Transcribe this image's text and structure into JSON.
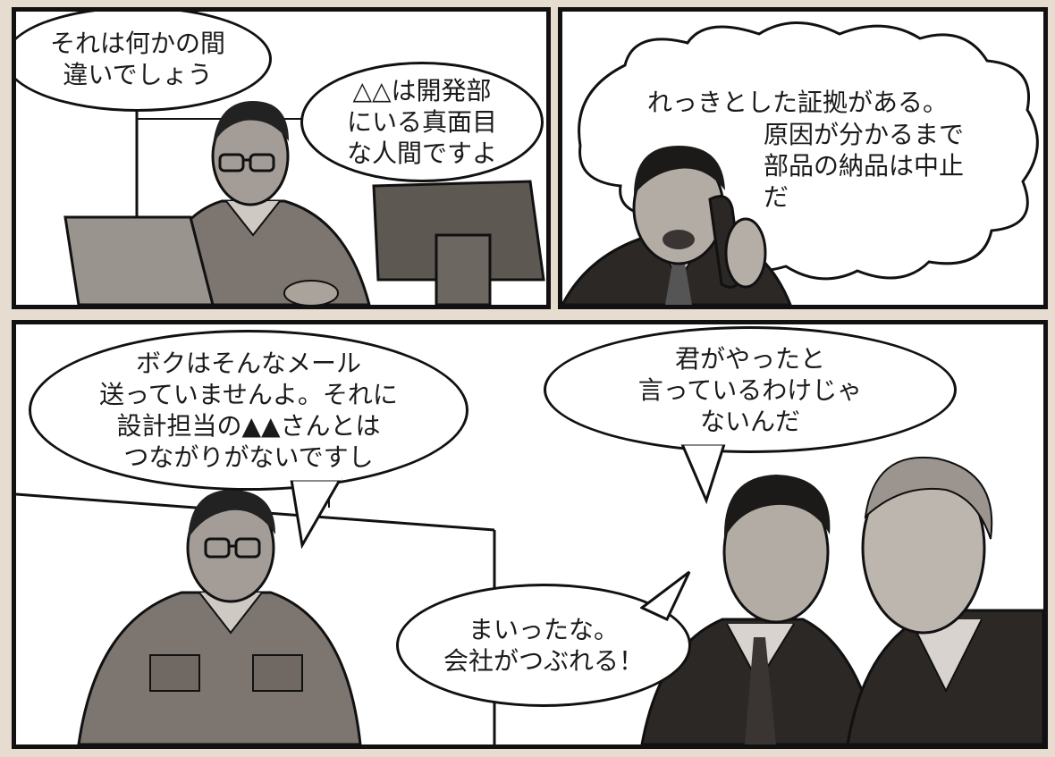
{
  "panels": [
    {
      "id": "panel-1",
      "balloons": [
        "それは何かの間\n違いでしょう",
        "△△は開発部\nにいる真面目\nな人間ですよ"
      ]
    },
    {
      "id": "panel-2",
      "balloons": [
        "れっきとした証拠がある。",
        "原因が分かるまで\n部品の納品は中止\nだ"
      ]
    },
    {
      "id": "panel-3",
      "balloons": [
        "ボクはそんなメール\n送っていませんよ。それに\n設計担当の▲▲さんとは\nつながりがないですし",
        "君がやったと\n言っているわけじゃ\nないんだ",
        "まいったな。\n会社がつぶれる！"
      ]
    }
  ],
  "colors": {
    "background": "#e6dccf",
    "ink": "#111111",
    "tone": "#8d8680",
    "paper": "#ffffff"
  }
}
